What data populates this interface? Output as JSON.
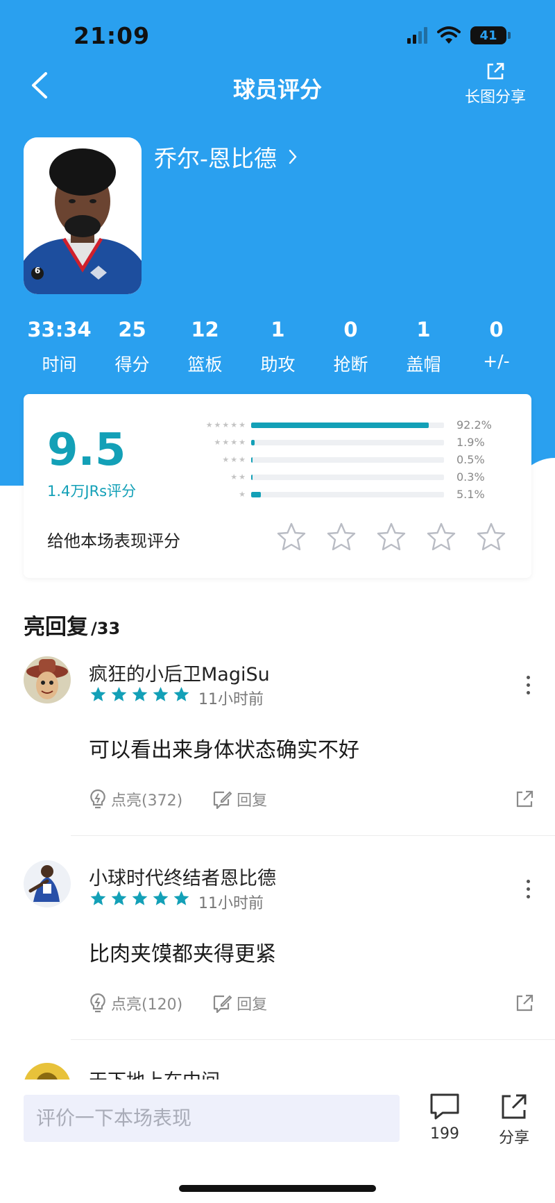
{
  "status_bar": {
    "time": "21:09",
    "battery": "41"
  },
  "nav": {
    "title": "球员评分",
    "share_long_label": "长图分享"
  },
  "player": {
    "name": "乔尔-恩比德",
    "jersey_number": "6"
  },
  "stats": [
    {
      "value": "33:34",
      "label": "时间"
    },
    {
      "value": "25",
      "label": "得分"
    },
    {
      "value": "12",
      "label": "篮板"
    },
    {
      "value": "1",
      "label": "助攻"
    },
    {
      "value": "0",
      "label": "抢断"
    },
    {
      "value": "1",
      "label": "盖帽"
    },
    {
      "value": "0",
      "label": "+/-"
    }
  ],
  "rating": {
    "score": "9.5",
    "count_label": "1.4万JRs评分",
    "distribution": [
      {
        "stars": 5,
        "percent": 92.2,
        "label": "92.2%"
      },
      {
        "stars": 4,
        "percent": 1.9,
        "label": "1.9%"
      },
      {
        "stars": 3,
        "percent": 0.5,
        "label": "0.5%"
      },
      {
        "stars": 2,
        "percent": 0.3,
        "label": "0.3%"
      },
      {
        "stars": 1,
        "percent": 5.1,
        "label": "5.1%"
      }
    ],
    "rate_prompt": "给他本场表现评分",
    "accent_color": "#13a0b7"
  },
  "comments_section": {
    "title": "亮回复",
    "count": "/33"
  },
  "comments": [
    {
      "user": "疯狂的小后卫MagiSu",
      "rating": 5,
      "time": "11小时前",
      "text": "可以看出来身体状态确实不好",
      "light_label": "点亮(372)",
      "reply_label": "回复"
    },
    {
      "user": "小球时代终结者恩比德",
      "rating": 5,
      "time": "11小时前",
      "text": "比肉夹馍都夹得更紧",
      "light_label": "点亮(120)",
      "reply_label": "回复"
    },
    {
      "user": "天下地上在中间"
    }
  ],
  "bottom_bar": {
    "input_placeholder": "评价一下本场表现",
    "comment_count": "199",
    "share_label": "分享"
  },
  "colors": {
    "header_blue": "#2aa0ef",
    "accent_teal": "#13a0b7"
  }
}
